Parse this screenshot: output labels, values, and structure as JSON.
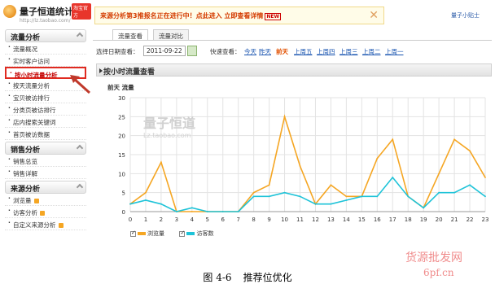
{
  "logo": {
    "name": "量子恒道统计",
    "beta": "淘宝官方",
    "url": "http://lz.taobao.com/"
  },
  "notice": {
    "text": "来源分析第3推报名正在进行中！点此进入 立即查看详情",
    "badge": "NEW",
    "close": "✕"
  },
  "tips": "量子小贴士",
  "sidebar": {
    "sections": [
      {
        "title": "流量分析",
        "items": [
          "流量概况",
          "实时客户访问",
          "按小时流量分析",
          "按天流量分析",
          "宝贝被访排行",
          "分类页被访排行",
          "店内搜索关键词",
          "首页被访数据"
        ]
      },
      {
        "title": "销售分析",
        "items": [
          "销售总览",
          "销售详解"
        ]
      },
      {
        "title": "来源分析",
        "items": [
          "浏览量",
          "访客分析",
          "自定义来源分析"
        ]
      }
    ],
    "active_item": "按小时流量分析"
  },
  "tabs": [
    "流量查看",
    "流量对比"
  ],
  "datebar": {
    "label": "选择日期查看：",
    "date": "2011-09-22",
    "quick_label": "快速查看：",
    "quick": [
      "今天",
      "昨天",
      "前天",
      "上周五",
      "上周四",
      "上周三",
      "上周二",
      "上周一"
    ],
    "selected": "前天"
  },
  "panel_title": "按小时流量查看",
  "chart_sub": "前天 流量",
  "watermark": {
    "line1": "量子恒道",
    "line2": "Lz.taobao.com"
  },
  "chart_data": {
    "type": "line",
    "x": [
      0,
      1,
      2,
      3,
      4,
      5,
      6,
      7,
      8,
      9,
      10,
      11,
      12,
      13,
      14,
      15,
      16,
      17,
      18,
      19,
      20,
      21,
      22,
      23
    ],
    "ylim": [
      0,
      30
    ],
    "yticks": [
      0,
      5,
      10,
      15,
      20,
      25,
      30
    ],
    "grid": true,
    "series": [
      {
        "name": "浏览量",
        "color": "#f5a623",
        "values": [
          2,
          5,
          13,
          0,
          0,
          0,
          0,
          0,
          5,
          7,
          25,
          12,
          2,
          7,
          4,
          4,
          14,
          19,
          4,
          1,
          10,
          19,
          16,
          9
        ]
      },
      {
        "name": "访客数",
        "color": "#1ec3d8",
        "values": [
          2,
          3,
          2,
          0,
          1,
          0,
          0,
          0,
          4,
          4,
          5,
          4,
          2,
          2,
          3,
          4,
          4,
          9,
          4,
          1,
          5,
          5,
          7,
          4
        ]
      }
    ]
  },
  "bottom_watermark": {
    "line1": "货源批发网",
    "line2": "6pf.cn"
  },
  "caption": {
    "num": "图 4-6",
    "text": "推荐位优化"
  }
}
